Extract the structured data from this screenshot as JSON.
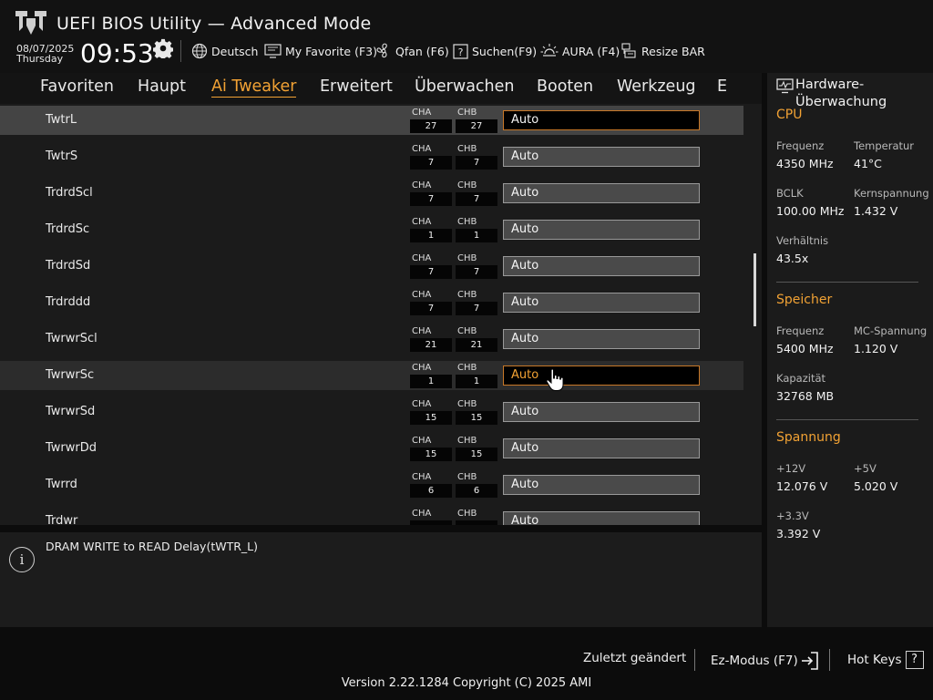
{
  "header": {
    "title": "UEFI BIOS Utility — Advanced Mode",
    "date": "08/07/2025",
    "weekday": "Thursday",
    "time": "09:53",
    "toolbar": [
      {
        "label": "Deutsch",
        "icon": "globe-icon"
      },
      {
        "label": "My Favorite (F3)",
        "icon": "favorite-monitor-icon"
      },
      {
        "label": "Qfan (F6)",
        "icon": "fan-icon"
      },
      {
        "label": "Suchen(F9)",
        "icon": "help-search-icon"
      },
      {
        "label": "AURA (F4)",
        "icon": "aura-light-icon"
      },
      {
        "label": "Resize BAR",
        "icon": "resize-bar-icon"
      }
    ]
  },
  "tabs": [
    "Favoriten",
    "Haupt",
    "Ai Tweaker",
    "Erweitert",
    "Überwachen",
    "Booten",
    "Werkzeug",
    "E"
  ],
  "active_tab": "Ai Tweaker",
  "channel_labels": {
    "a": "CHA",
    "b": "CHB"
  },
  "rows": [
    {
      "label": "TwtrL",
      "cha": "27",
      "chb": "27",
      "value": "Auto"
    },
    {
      "label": "TwtrS",
      "cha": "7",
      "chb": "7",
      "value": "Auto"
    },
    {
      "label": "TrdrdScl",
      "cha": "7",
      "chb": "7",
      "value": "Auto"
    },
    {
      "label": "TrdrdSc",
      "cha": "1",
      "chb": "1",
      "value": "Auto"
    },
    {
      "label": "TrdrdSd",
      "cha": "7",
      "chb": "7",
      "value": "Auto"
    },
    {
      "label": "Trdrddd",
      "cha": "7",
      "chb": "7",
      "value": "Auto"
    },
    {
      "label": "TwrwrScl",
      "cha": "21",
      "chb": "21",
      "value": "Auto"
    },
    {
      "label": "TwrwrSc",
      "cha": "1",
      "chb": "1",
      "value": "Auto"
    },
    {
      "label": "TwrwrSd",
      "cha": "15",
      "chb": "15",
      "value": "Auto"
    },
    {
      "label": "TwrwrDd",
      "cha": "15",
      "chb": "15",
      "value": "Auto"
    },
    {
      "label": "Twrrd",
      "cha": "6",
      "chb": "6",
      "value": "Auto"
    },
    {
      "label": "Trdwr",
      "cha": "",
      "chb": "",
      "value": "Auto"
    }
  ],
  "help_text": "DRAM WRITE to READ Delay(tWTR_L)",
  "hardware_monitor": {
    "title": "Hardware-Überwachung",
    "cpu": {
      "section": "CPU",
      "freq_label": "Frequenz",
      "freq": "4350 MHz",
      "temp_label": "Temperatur",
      "temp": "41°C",
      "bclk_label": "BCLK",
      "bclk": "100.00 MHz",
      "vcore_label": "Kernspannung",
      "vcore": "1.432 V",
      "ratio_label": "Verhältnis",
      "ratio": "43.5x"
    },
    "memory": {
      "section": "Speicher",
      "freq_label": "Frequenz",
      "freq": "5400 MHz",
      "mc_label": "MC-Spannung",
      "mc": "1.120 V",
      "cap_label": "Kapazität",
      "cap": "32768 MB"
    },
    "voltage": {
      "section": "Spannung",
      "v12_label": "+12V",
      "v12": "12.076 V",
      "v5_label": "+5V",
      "v5": "5.020 V",
      "v33_label": "+3.3V",
      "v33": "3.392 V"
    }
  },
  "footer": {
    "last_changed": "Zuletzt geändert",
    "ez_mode": "Ez-Modus (F7)",
    "hot_keys": "Hot Keys",
    "hot_keys_key": "?",
    "version": "Version 2.22.1284 Copyright (C) 2025 AMI"
  },
  "colors": {
    "accent": "#f2a234",
    "background": "#0c0c0c",
    "panel": "#1b1b1b",
    "selected_row": "#444444"
  }
}
